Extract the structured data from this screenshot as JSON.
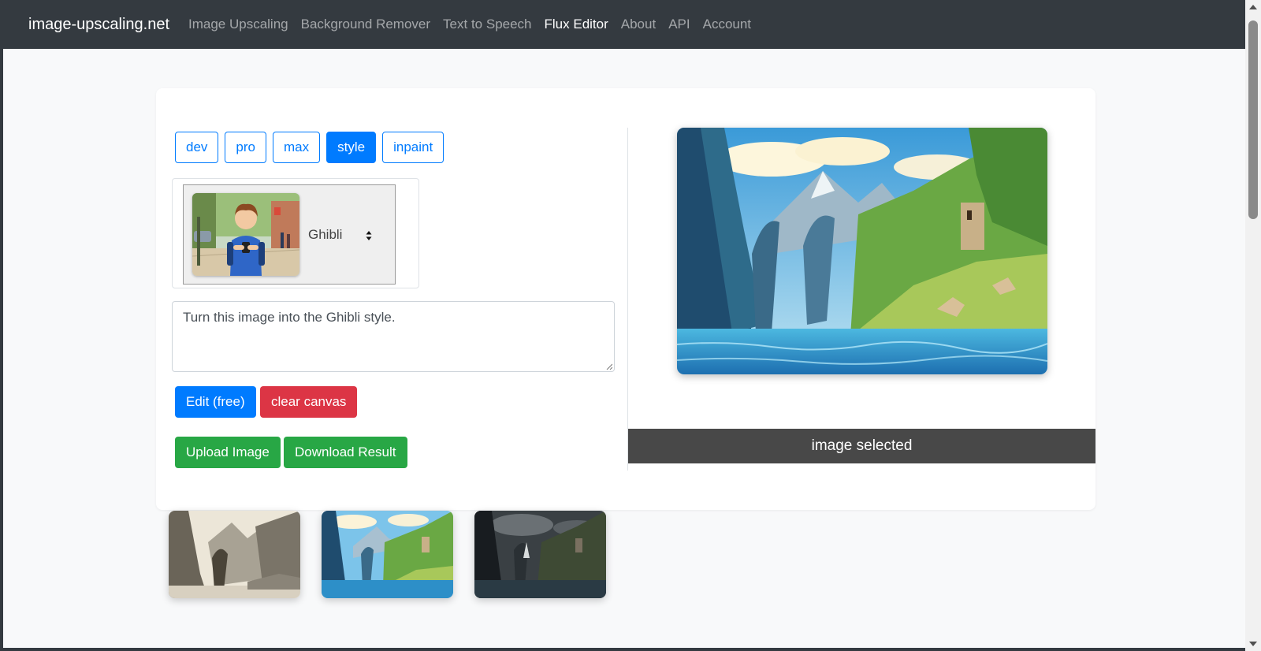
{
  "navbar": {
    "brand": "image-upscaling.net",
    "links": [
      {
        "label": "Image Upscaling",
        "active": false
      },
      {
        "label": "Background Remover",
        "active": false
      },
      {
        "label": "Text to Speech",
        "active": false
      },
      {
        "label": "Flux Editor",
        "active": true
      },
      {
        "label": "About",
        "active": false
      },
      {
        "label": "API",
        "active": false
      },
      {
        "label": "Account",
        "active": false
      }
    ]
  },
  "editor": {
    "model_tabs": [
      {
        "label": "dev",
        "active": false
      },
      {
        "label": "pro",
        "active": false
      },
      {
        "label": "max",
        "active": false
      },
      {
        "label": "style",
        "active": true
      },
      {
        "label": "inpaint",
        "active": false
      }
    ],
    "style_select": {
      "selected_label": "Ghibli",
      "thumbnail_icon": "boy-with-phone-thumbnail"
    },
    "prompt_text": "Turn this image into the Ghibli style.",
    "buttons": {
      "edit": "Edit (free)",
      "clear": "clear canvas",
      "upload": "Upload Image",
      "download": "Download Result"
    },
    "status_text": "image selected",
    "result_image_icon": "fjord-landscape-ghibli"
  },
  "gallery": [
    {
      "name": "sketch-fjord-thumbnail"
    },
    {
      "name": "ghibli-fjord-thumbnail"
    },
    {
      "name": "dark-fjord-thumbnail"
    }
  ],
  "colors": {
    "navbar_bg": "#343a40",
    "primary": "#007bff",
    "danger": "#dc3545",
    "success": "#28a745",
    "status_bar": "#484848"
  }
}
